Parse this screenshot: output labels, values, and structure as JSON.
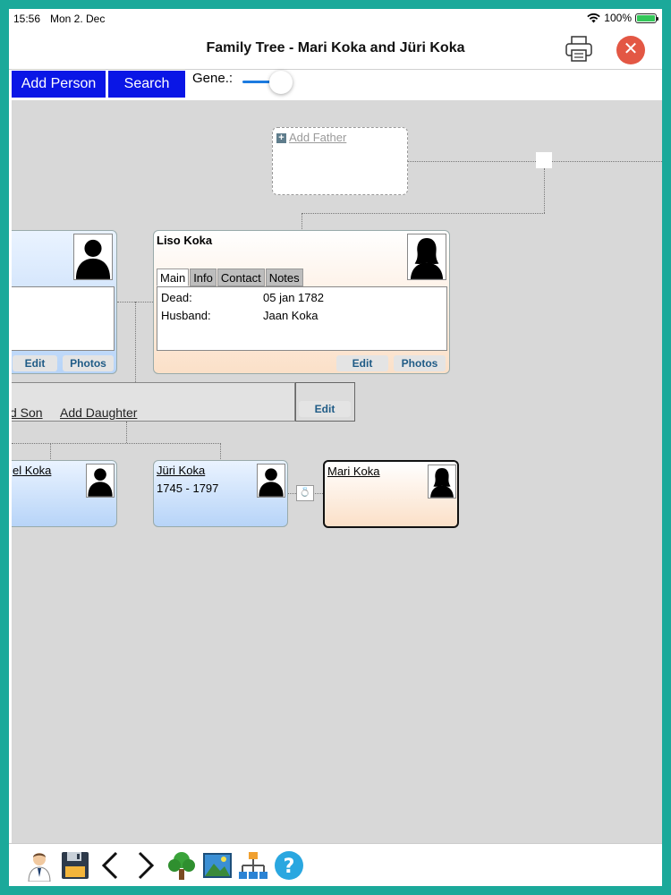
{
  "status": {
    "time": "15:56",
    "date": "Mon 2. Dec",
    "battery": "100%",
    "battery_level": 1.0
  },
  "nav": {
    "title": "Family Tree - Mari Koka and Jüri Koka",
    "close_glyph": "✕"
  },
  "toolbar": {
    "add_person": "Add Person",
    "search": "Search",
    "gene_label": "Gene.:"
  },
  "tree": {
    "add_father": "Add Father",
    "left_parent": {
      "edit": "Edit",
      "photos": "Photos"
    },
    "mother": {
      "name": "Liso Koka",
      "tabs": [
        "Main",
        "Info",
        "Contact",
        "Notes"
      ],
      "rows": [
        {
          "label": "Dead:",
          "value": "05 jan 1782"
        },
        {
          "label": "Husband:",
          "value": "Jaan Koka"
        }
      ],
      "edit": "Edit",
      "photos": "Photos"
    },
    "family": {
      "add_son": "d Son",
      "add_daughter": "Add Daughter",
      "edit": "Edit"
    },
    "children": [
      {
        "name": "el Koka",
        "years": ""
      },
      {
        "name": "Jüri Koka",
        "years": "1745 - 1797"
      }
    ],
    "spouse": {
      "name": "Mari Koka"
    }
  },
  "bottom_icons": [
    "person-icon",
    "save-icon",
    "back-arrow-icon",
    "forward-arrow-icon",
    "tree-icon",
    "image-icon",
    "hierarchy-icon",
    "help-icon"
  ],
  "colors": {
    "accent_blue": "#0a16e6",
    "frame": "#1ba99a",
    "close_red": "#e35744"
  }
}
